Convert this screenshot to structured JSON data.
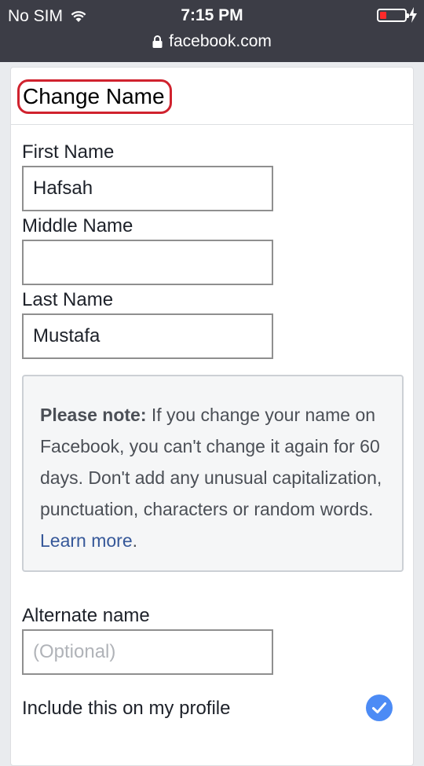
{
  "status_bar": {
    "carrier": "No SIM",
    "time": "7:15 PM",
    "battery_level": 0.2,
    "battery_color": "#ff2a2a"
  },
  "url_bar": {
    "url": "facebook.com"
  },
  "page": {
    "title": "Change Name",
    "title_highlight_color": "#d0222e"
  },
  "form": {
    "first_name": {
      "label": "First Name",
      "value": "Hafsah"
    },
    "middle_name": {
      "label": "Middle Name",
      "value": ""
    },
    "last_name": {
      "label": "Last Name",
      "value": "Mustafa"
    },
    "note": {
      "bold_prefix": "Please note:",
      "text": " If you change your name on Facebook, you can't change it again for 60 days. Don't add any unusual capitalization, punctuation, characters or random words. ",
      "link": "Learn more",
      "suffix": "."
    },
    "alternate_name": {
      "label": "Alternate name",
      "value": "",
      "placeholder": "(Optional)"
    },
    "include_on_profile": {
      "label": "Include this on my profile",
      "checked": true,
      "check_color": "#4c8bf5"
    }
  },
  "icons": [
    "wifi-icon",
    "battery-icon",
    "charging-icon",
    "lock-icon",
    "checkmark-circle-icon"
  ]
}
